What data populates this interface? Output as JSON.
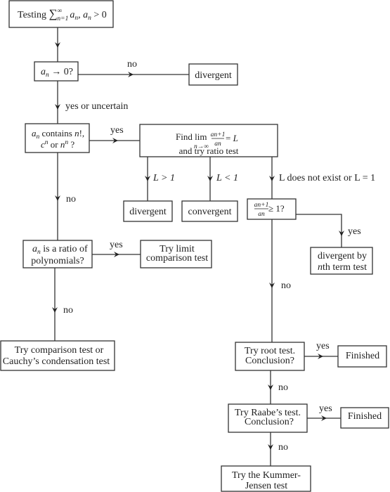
{
  "title_box": {
    "prefix": "Testing ",
    "sum": "∑",
    "sup": "∞",
    "sub": "n=1",
    "a1": "a",
    "n1": "n",
    "comma": ", ",
    "a2": "a",
    "n2": "n",
    "cond": " > 0"
  },
  "q_limit_zero": {
    "a": "a",
    "n": "n",
    "rest": " → 0?"
  },
  "divergent_top": "divergent",
  "label_no_1": "no",
  "label_yes_uncertain": "yes or uncertain",
  "q_factorial": {
    "a": "a",
    "n": "n",
    "rest1": " contains ",
    "nfact": "n",
    "bang": "!,",
    "c": "c",
    "cexp": "n",
    "or": " or ",
    "nn": "n",
    "nexp": "n",
    "q": " ?"
  },
  "label_yes_1": "yes",
  "ratio_box": {
    "find": "Find  lim",
    "under": "n→∞",
    "num": "an+1",
    "den": "an",
    "eq": " = ",
    "L": "L",
    "line2": "and try ratio test"
  },
  "label_L_gt_1": "L > 1",
  "label_L_lt_1": "L < 1",
  "label_L_other": "L does not exist or L = 1",
  "divergent_mid": "divergent",
  "convergent": "convergent",
  "q_ratio_ge1": {
    "num": "an+1",
    "den": "an",
    "rest": " ≥ 1?"
  },
  "label_yes_2": "yes",
  "divergent_nth": {
    "line1": "divergent by",
    "n": "n",
    "line2": "th term test"
  },
  "label_no_2": "no",
  "q_polynomials": {
    "a": "a",
    "n": "n",
    "line1": " is a ratio of",
    "line2": "polynomials?"
  },
  "label_yes_3": "yes",
  "limit_comparison": {
    "line1": "Try limit",
    "line2": "comparison test"
  },
  "label_no_3": "no",
  "comparison_box": {
    "line1": "Try comparison test or",
    "line2": "Cauchy’s condensation test"
  },
  "label_no_4": "no",
  "root_box": {
    "line1": "Try root test.",
    "line2": "Conclusion?"
  },
  "label_yes_4": "yes",
  "finished_1": "Finished",
  "label_no_5": "no",
  "raabe_box": {
    "line1": "Try Raabe’s test.",
    "line2": "Conclusion?"
  },
  "label_yes_5": "yes",
  "finished_2": "Finished",
  "label_no_6": "no",
  "kummer_box": {
    "line1": "Try the Kummer-",
    "line2": "Jensen test"
  }
}
